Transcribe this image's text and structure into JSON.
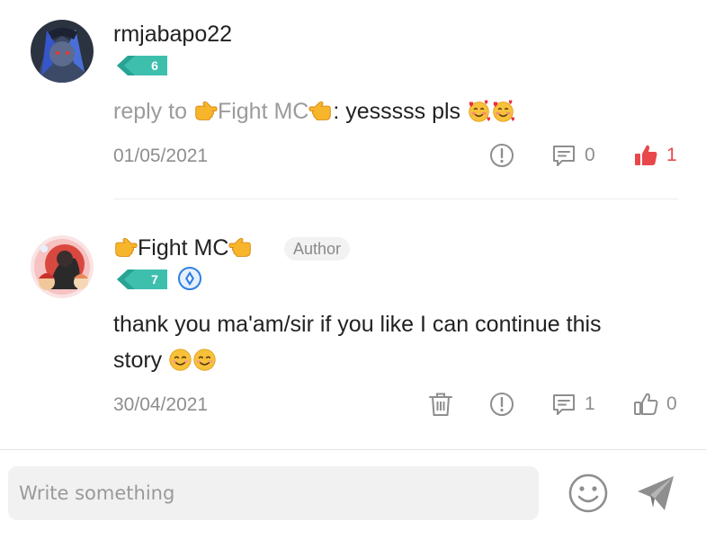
{
  "comments": [
    {
      "username": "rmjabapo22",
      "level": "6",
      "reply_prefix": "reply to ",
      "reply_target": "Fight MC",
      "reply_sep": ": ",
      "text": "yesssss pls ",
      "date": "01/05/2021",
      "reply_count": "0",
      "like_count": "1",
      "liked": true
    },
    {
      "username": "Fight MC",
      "author_label": "Author",
      "level": "7",
      "text_line1": "thank you ma'am/sir if you like I can continue this",
      "text_line2": "story ",
      "date": "30/04/2021",
      "reply_count": "1",
      "like_count": "0",
      "liked": false
    }
  ],
  "composer": {
    "placeholder": "Write something"
  },
  "colors": {
    "level_badge": "#3ebfae",
    "like_active": "#e8474b",
    "icon_gray": "#8e8e8e",
    "verified_blue": "#2f7fe0"
  },
  "icons": [
    "report-icon",
    "reply-icon",
    "like-icon",
    "delete-icon",
    "emoji-picker-icon",
    "send-icon",
    "verified-icon"
  ]
}
